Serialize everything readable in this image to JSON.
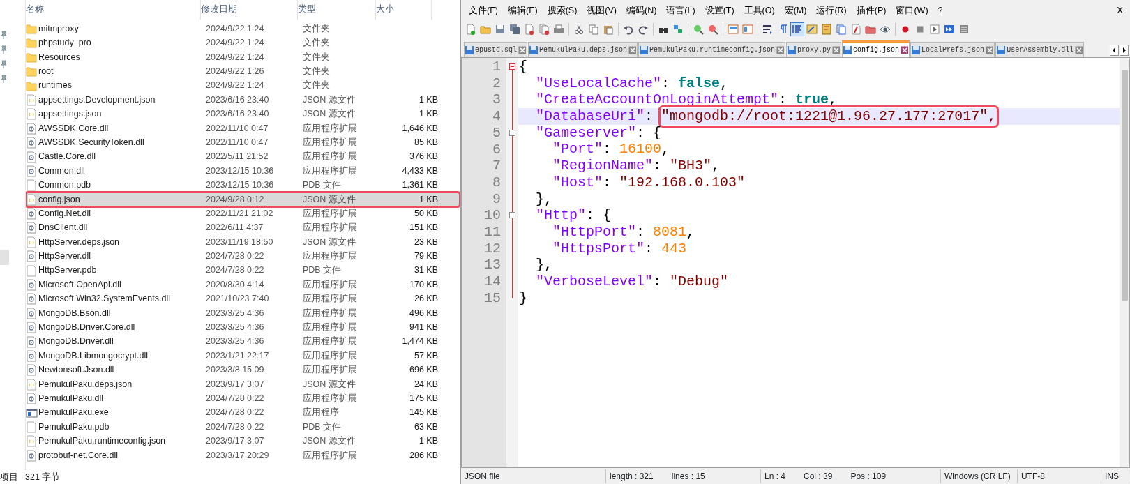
{
  "explorer": {
    "columns": [
      "名称",
      "修改日期",
      "类型",
      "大小"
    ],
    "files": [
      {
        "kind": "folder",
        "name": "mitmproxy",
        "date": "2024/9/22 1:24",
        "type": "文件夹",
        "selected": false
      },
      {
        "kind": "folder",
        "name": "phpstudy_pro",
        "date": "2024/9/22 1:24",
        "type": "文件夹",
        "selected": false
      },
      {
        "kind": "folder",
        "name": "Resources",
        "date": "2024/9/22 1:24",
        "type": "文件夹",
        "selected": false
      },
      {
        "kind": "folder",
        "name": "root",
        "date": "2024/9/22 1:26",
        "type": "文件夹",
        "selected": false
      },
      {
        "kind": "folder",
        "name": "runtimes",
        "date": "2024/9/22 1:24",
        "type": "文件夹",
        "selected": false
      },
      {
        "kind": "json",
        "name": "appsettings.Development.json",
        "date": "2023/6/16 23:40",
        "type": "JSON 源文件",
        "size": "1 KB",
        "selected": false
      },
      {
        "kind": "json",
        "name": "appsettings.json",
        "date": "2023/6/16 23:40",
        "type": "JSON 源文件",
        "size": "1 KB",
        "selected": false
      },
      {
        "kind": "dll",
        "name": "AWSSDK.Core.dll",
        "date": "2022/11/10 0:47",
        "type": "应用程序扩展",
        "size": "1,646 KB",
        "selected": false
      },
      {
        "kind": "dll",
        "name": "AWSSDK.SecurityToken.dll",
        "date": "2022/11/10 0:47",
        "type": "应用程序扩展",
        "size": "85 KB",
        "selected": false
      },
      {
        "kind": "dll",
        "name": "Castle.Core.dll",
        "date": "2022/5/11 21:52",
        "type": "应用程序扩展",
        "size": "376 KB",
        "selected": false
      },
      {
        "kind": "dll",
        "name": "Common.dll",
        "date": "2023/12/15 10:36",
        "type": "应用程序扩展",
        "size": "4,433 KB",
        "selected": false
      },
      {
        "kind": "pdb",
        "name": "Common.pdb",
        "date": "2023/12/15 10:36",
        "type": "PDB 文件",
        "size": "1,361 KB",
        "selected": false
      },
      {
        "kind": "json",
        "name": "config.json",
        "date": "2024/9/28 0:12",
        "type": "JSON 源文件",
        "size": "1 KB",
        "selected": true
      },
      {
        "kind": "dll",
        "name": "Config.Net.dll",
        "date": "2022/11/21 21:02",
        "type": "应用程序扩展",
        "size": "50 KB",
        "selected": false
      },
      {
        "kind": "dll",
        "name": "DnsClient.dll",
        "date": "2022/6/11 4:37",
        "type": "应用程序扩展",
        "size": "151 KB",
        "selected": false
      },
      {
        "kind": "json",
        "name": "HttpServer.deps.json",
        "date": "2023/11/19 18:50",
        "type": "JSON 源文件",
        "size": "23 KB",
        "selected": false
      },
      {
        "kind": "dll",
        "name": "HttpServer.dll",
        "date": "2024/7/28 0:22",
        "type": "应用程序扩展",
        "size": "79 KB",
        "selected": false
      },
      {
        "kind": "pdb",
        "name": "HttpServer.pdb",
        "date": "2024/7/28 0:22",
        "type": "PDB 文件",
        "size": "31 KB",
        "selected": false
      },
      {
        "kind": "dll",
        "name": "Microsoft.OpenApi.dll",
        "date": "2020/8/30 4:14",
        "type": "应用程序扩展",
        "size": "170 KB",
        "selected": false
      },
      {
        "kind": "dll",
        "name": "Microsoft.Win32.SystemEvents.dll",
        "date": "2021/10/23 7:40",
        "type": "应用程序扩展",
        "size": "26 KB",
        "selected": false
      },
      {
        "kind": "dll",
        "name": "MongoDB.Bson.dll",
        "date": "2023/3/25 4:36",
        "type": "应用程序扩展",
        "size": "496 KB",
        "selected": false
      },
      {
        "kind": "dll",
        "name": "MongoDB.Driver.Core.dll",
        "date": "2023/3/25 4:36",
        "type": "应用程序扩展",
        "size": "941 KB",
        "selected": false
      },
      {
        "kind": "dll",
        "name": "MongoDB.Driver.dll",
        "date": "2023/3/25 4:36",
        "type": "应用程序扩展",
        "size": "1,474 KB",
        "selected": false
      },
      {
        "kind": "dll",
        "name": "MongoDB.Libmongocrypt.dll",
        "date": "2023/1/21 22:17",
        "type": "应用程序扩展",
        "size": "57 KB",
        "selected": false
      },
      {
        "kind": "dll",
        "name": "Newtonsoft.Json.dll",
        "date": "2023/3/8 15:09",
        "type": "应用程序扩展",
        "size": "696 KB",
        "selected": false
      },
      {
        "kind": "json",
        "name": "PemukulPaku.deps.json",
        "date": "2023/9/17 3:07",
        "type": "JSON 源文件",
        "size": "24 KB",
        "selected": false
      },
      {
        "kind": "dll",
        "name": "PemukulPaku.dll",
        "date": "2024/7/28 0:22",
        "type": "应用程序扩展",
        "size": "175 KB",
        "selected": false
      },
      {
        "kind": "exe",
        "name": "PemukulPaku.exe",
        "date": "2024/7/28 0:22",
        "type": "应用程序",
        "size": "145 KB",
        "selected": false
      },
      {
        "kind": "pdb",
        "name": "PemukulPaku.pdb",
        "date": "2024/7/28 0:22",
        "type": "PDB 文件",
        "size": "63 KB",
        "selected": false
      },
      {
        "kind": "json",
        "name": "PemukulPaku.runtimeconfig.json",
        "date": "2023/9/17 3:07",
        "type": "JSON 源文件",
        "size": "1 KB",
        "selected": false
      },
      {
        "kind": "dll",
        "name": "protobuf-net.Core.dll",
        "date": "2023/3/17 20:29",
        "type": "应用程序扩展",
        "size": "286 KB",
        "selected": false
      }
    ],
    "status": [
      "项目",
      "321 字节"
    ]
  },
  "editor": {
    "menu": [
      "文件(F)",
      "编辑(E)",
      "搜索(S)",
      "视图(V)",
      "编码(N)",
      "语言(L)",
      "设置(T)",
      "工具(O)",
      "宏(M)",
      "运行(R)",
      "插件(P)",
      "窗口(W)",
      "?"
    ],
    "close": "X",
    "toolbar": [
      {
        "kind": "new",
        "pressed": false
      },
      {
        "kind": "open",
        "pressed": false
      },
      {
        "kind": "save",
        "pressed": false
      },
      {
        "kind": "save-all",
        "pressed": false
      },
      {
        "kind": "close",
        "pressed": false
      },
      {
        "kind": "close-all",
        "pressed": false
      },
      {
        "kind": "print",
        "pressed": false
      },
      {
        "kind": "sep"
      },
      {
        "kind": "cut",
        "pressed": false
      },
      {
        "kind": "copy",
        "pressed": false
      },
      {
        "kind": "paste",
        "pressed": false
      },
      {
        "kind": "sep"
      },
      {
        "kind": "undo",
        "pressed": false
      },
      {
        "kind": "redo",
        "pressed": false
      },
      {
        "kind": "sep"
      },
      {
        "kind": "find",
        "pressed": false
      },
      {
        "kind": "replace",
        "pressed": false
      },
      {
        "kind": "sep"
      },
      {
        "kind": "zoom-in",
        "pressed": false
      },
      {
        "kind": "zoom-out",
        "pressed": false
      },
      {
        "kind": "sep"
      },
      {
        "kind": "sync-v",
        "pressed": false
      },
      {
        "kind": "sync-h",
        "pressed": false
      },
      {
        "kind": "sep"
      },
      {
        "kind": "wrap",
        "pressed": false
      },
      {
        "kind": "pilcrow",
        "pressed": false
      },
      {
        "kind": "indent",
        "pressed": true
      },
      {
        "kind": "udl",
        "pressed": false
      },
      {
        "kind": "map",
        "pressed": false
      },
      {
        "kind": "list",
        "pressed": false
      },
      {
        "kind": "func",
        "pressed": false
      },
      {
        "kind": "folder",
        "pressed": false
      },
      {
        "kind": "eye",
        "pressed": false
      },
      {
        "kind": "sep"
      },
      {
        "kind": "record",
        "pressed": false
      },
      {
        "kind": "stop",
        "pressed": false
      },
      {
        "kind": "play",
        "pressed": false
      },
      {
        "kind": "play-multi",
        "pressed": false
      },
      {
        "kind": "save-macro",
        "pressed": false
      }
    ],
    "tabs": [
      {
        "label": "epustd.sql",
        "selected": false
      },
      {
        "label": "PemukulPaku.deps.json",
        "selected": false
      },
      {
        "label": "PemukulPaku.runtimeconfig.json",
        "selected": false
      },
      {
        "label": "proxy.py",
        "selected": false
      },
      {
        "label": "config.json",
        "selected": true
      },
      {
        "label": "LocalPrefs.json",
        "selected": false
      },
      {
        "label": "UserAssembly.dll",
        "selected": false
      }
    ],
    "lines": [
      {
        "number": "1",
        "foldable": true,
        "fold_active": true,
        "current": false,
        "tokens": [
          {
            "kind": "punct",
            "text": "{"
          }
        ]
      },
      {
        "number": "2",
        "foldable": false,
        "current": false,
        "tokens": [
          {
            "kind": "key",
            "text": "  \"UseLocalCache\""
          },
          {
            "kind": "punct",
            "text": ": "
          },
          {
            "kind": "bool",
            "text": "false"
          },
          {
            "kind": "punct",
            "text": ","
          }
        ]
      },
      {
        "number": "3",
        "foldable": false,
        "current": false,
        "tokens": [
          {
            "kind": "key",
            "text": "  \"CreateAccountOnLoginAttempt\""
          },
          {
            "kind": "punct",
            "text": ": "
          },
          {
            "kind": "bool",
            "text": "true"
          },
          {
            "kind": "punct",
            "text": ","
          }
        ]
      },
      {
        "number": "4",
        "foldable": false,
        "current": true,
        "tokens": [
          {
            "kind": "key",
            "text": "  \"DatabaseUri\""
          },
          {
            "kind": "punct",
            "text": ": "
          },
          {
            "kind": "str",
            "text": "\"mongodb://root:1221@1.96.27.177:27017\",",
            "highlighted": true
          }
        ]
      },
      {
        "number": "5",
        "foldable": true,
        "fold_active": false,
        "current": false,
        "tokens": [
          {
            "kind": "key",
            "text": "  \"Gameserver\""
          },
          {
            "kind": "punct",
            "text": ": {"
          }
        ]
      },
      {
        "number": "6",
        "foldable": false,
        "current": false,
        "tokens": [
          {
            "kind": "key",
            "text": "    \"Port\""
          },
          {
            "kind": "punct",
            "text": ": "
          },
          {
            "kind": "num",
            "text": "16100"
          },
          {
            "kind": "punct",
            "text": ","
          }
        ]
      },
      {
        "number": "7",
        "foldable": false,
        "current": false,
        "tokens": [
          {
            "kind": "key",
            "text": "    \"RegionName\""
          },
          {
            "kind": "punct",
            "text": ": "
          },
          {
            "kind": "str",
            "text": "\"BH3\""
          },
          {
            "kind": "punct",
            "text": ","
          }
        ]
      },
      {
        "number": "8",
        "foldable": false,
        "current": false,
        "tokens": [
          {
            "kind": "key",
            "text": "    \"Host\""
          },
          {
            "kind": "punct",
            "text": ": "
          },
          {
            "kind": "str",
            "text": "\"192.168.0.103\""
          }
        ]
      },
      {
        "number": "9",
        "foldable": false,
        "current": false,
        "tokens": [
          {
            "kind": "punct",
            "text": "  },"
          }
        ]
      },
      {
        "number": "10",
        "foldable": true,
        "fold_active": false,
        "current": false,
        "tokens": [
          {
            "kind": "key",
            "text": "  \"Http\""
          },
          {
            "kind": "punct",
            "text": ": {"
          }
        ]
      },
      {
        "number": "11",
        "foldable": false,
        "current": false,
        "tokens": [
          {
            "kind": "key",
            "text": "    \"HttpPort\""
          },
          {
            "kind": "punct",
            "text": ": "
          },
          {
            "kind": "num",
            "text": "8081"
          },
          {
            "kind": "punct",
            "text": ","
          }
        ]
      },
      {
        "number": "12",
        "foldable": false,
        "current": false,
        "tokens": [
          {
            "kind": "key",
            "text": "    \"HttpsPort\""
          },
          {
            "kind": "punct",
            "text": ": "
          },
          {
            "kind": "num",
            "text": "443"
          }
        ]
      },
      {
        "number": "13",
        "foldable": false,
        "current": false,
        "tokens": [
          {
            "kind": "punct",
            "text": "  },"
          }
        ]
      },
      {
        "number": "14",
        "foldable": false,
        "current": false,
        "tokens": [
          {
            "kind": "key",
            "text": "  \"VerboseLevel\""
          },
          {
            "kind": "punct",
            "text": ": "
          },
          {
            "kind": "str",
            "text": "\"Debug\""
          }
        ]
      },
      {
        "number": "15",
        "foldable": false,
        "current": false,
        "tokens": [
          {
            "kind": "punct",
            "text": "}"
          }
        ]
      }
    ],
    "status": [
      [
        "JSON file"
      ],
      [
        "length : 321",
        "lines : 15"
      ],
      [
        "Ln : 4",
        "Col : 39",
        "Pos : 109"
      ],
      [
        "Windows (CR LF)"
      ],
      [
        "UTF-8"
      ],
      [
        "INS"
      ]
    ]
  }
}
